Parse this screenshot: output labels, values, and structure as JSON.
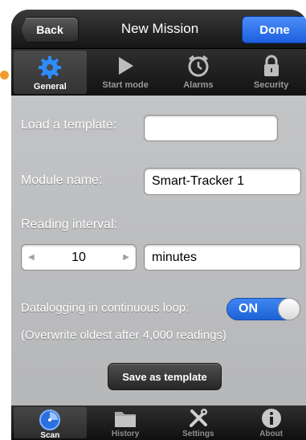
{
  "navbar": {
    "back_label": "Back",
    "title": "New Mission",
    "done_label": "Done"
  },
  "top_tabs": [
    {
      "label": "General",
      "icon": "gear-icon",
      "active": true
    },
    {
      "label": "Start mode",
      "icon": "play-icon",
      "active": false
    },
    {
      "label": "Alarms",
      "icon": "alarm-clock-icon",
      "active": false
    },
    {
      "label": "Security",
      "icon": "lock-icon",
      "active": false
    }
  ],
  "form": {
    "template_label": "Load a template:",
    "template_value": "",
    "module_label": "Module name:",
    "module_value": "Smart-Tracker 1",
    "interval_label": "Reading interval:",
    "interval_value": "10",
    "interval_unit": "minutes",
    "loop_label": "Datalogging in continuous loop:",
    "loop_toggle": "ON",
    "loop_note": "(Overwrite oldest after 4,000 readings)",
    "save_template_label": "Save as template"
  },
  "bottom_tabs": [
    {
      "label": "Scan",
      "icon": "scan-icon",
      "active": true
    },
    {
      "label": "History",
      "icon": "folder-icon",
      "active": false
    },
    {
      "label": "Settings",
      "icon": "tools-icon",
      "active": false
    },
    {
      "label": "About",
      "icon": "info-icon",
      "active": false
    }
  ],
  "colors": {
    "accent": "#2b74ec",
    "background": "#bdbec0",
    "bar": "#1e1e1e"
  }
}
